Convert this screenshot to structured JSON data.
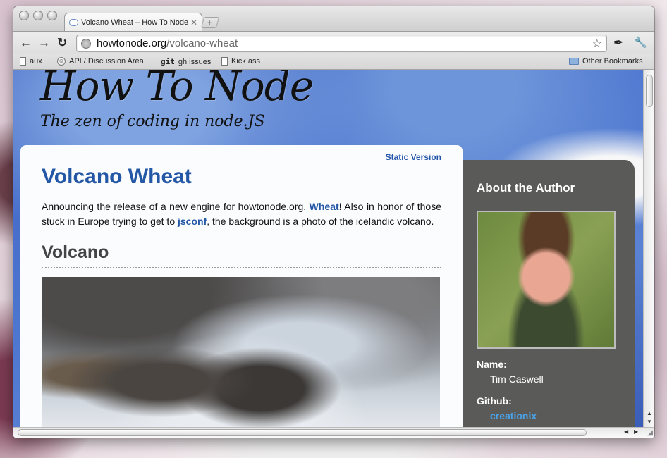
{
  "browser": {
    "tab": {
      "title": "Volcano Wheat – How To Node",
      "close_glyph": "✕"
    },
    "new_tab_glyph": "+",
    "toolbar": {
      "back_glyph": "←",
      "forward_glyph": "→",
      "reload_glyph": "↻",
      "url_host": "howtonode.org",
      "url_path": "/volcano-wheat",
      "bookmark_star_glyph": "☆",
      "page_menu_glyph": "✒",
      "wrench_menu_glyph": "🔧"
    },
    "bookmarks": [
      {
        "label": "aux",
        "icon": "page-icon"
      },
      {
        "label": "API / Discussion Area",
        "icon": "smile-icon"
      },
      {
        "label": "gh issues",
        "icon": "git-icon",
        "icon_text": "git"
      },
      {
        "label": "Kick ass",
        "icon": "page-icon"
      }
    ],
    "other_bookmarks": "Other Bookmarks"
  },
  "site": {
    "title": "How To Node",
    "tagline": "The zen of coding in node.JS"
  },
  "article": {
    "static_version_link": "Static Version",
    "title": "Volcano Wheat",
    "intro_part1": "Announcing the release of a new engine for howtonode.org, ",
    "intro_link1": "Wheat",
    "intro_part2": "! Also in honor of those stuck in Europe trying to get to ",
    "intro_link2": "jsconf",
    "intro_part3": ", the background is a photo of the icelandic volcano.",
    "section_heading": "Volcano"
  },
  "sidebar": {
    "heading": "About the Author",
    "name_label": "Name:",
    "name_value": "Tim Caswell",
    "github_label": "Github:",
    "github_value": "creationix"
  },
  "colors": {
    "link": "#2458a7",
    "sidebar_bg": "#5a5a58",
    "github_link": "#4aa3e8"
  }
}
